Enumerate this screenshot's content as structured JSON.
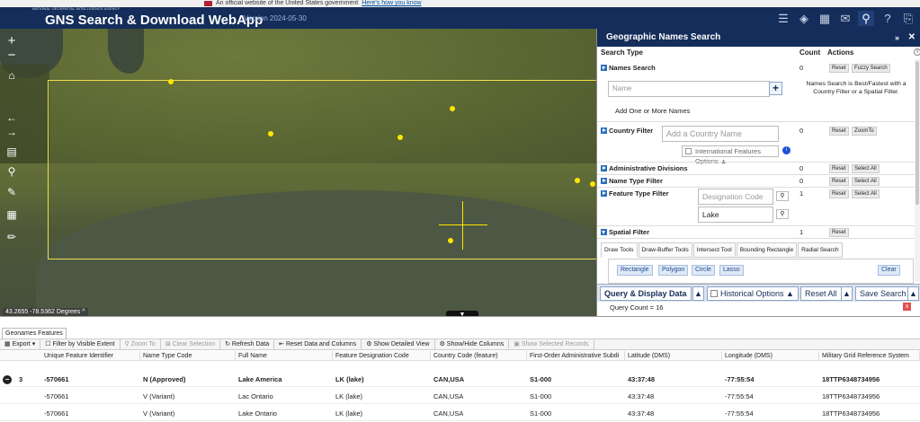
{
  "gov_banner": {
    "text": "An official website of the United States government",
    "link": "Here's how you know"
  },
  "header": {
    "agency": "NATIONAL GEOSPATIAL-INTELLIGENCE AGENCY",
    "title": "GNS Search & Download WebApp",
    "version": "Version 2024-05-30",
    "icons": [
      "list-icon",
      "layers-icon",
      "basemap-icon",
      "feedback-icon",
      "search-icon",
      "help-icon",
      "link-icon"
    ]
  },
  "map": {
    "coordinates": "43.2655 -78.5362 Degrees",
    "coord_toggle": "^",
    "collapse": "▼",
    "tools": [
      "+",
      "−",
      "⌂",
      "←",
      "→",
      "▤",
      "🔍",
      "✎",
      "▦",
      "✏"
    ]
  },
  "panel": {
    "title": "Geographic Names Search",
    "collapse": "»",
    "close": "✕",
    "col_search_type": "Search Type",
    "col_count": "Count",
    "col_actions": "Actions",
    "info_icon": "i",
    "names_search": {
      "label": "Names Search",
      "count": "0",
      "reset": "Reset",
      "fuzzy": "Fuzzy Search",
      "placeholder": "Name",
      "add_btn": "+",
      "hint": "Names Search is Best/Fastest with a Country Filter or a Spatial Filter.",
      "add_more": "Add One or More Names"
    },
    "country_filter": {
      "label": "Country Filter",
      "placeholder": "Add a Country Name",
      "count": "0",
      "reset": "Reset",
      "zoom": "ZoomTo",
      "intl_options": "International Features Options ▲"
    },
    "admin_divisions": {
      "label": "Administrative Divisions",
      "count": "0",
      "reset": "Reset",
      "select_all": "Select All"
    },
    "name_type_filter": {
      "label": "Name Type Filter",
      "count": "0",
      "reset": "Reset",
      "select_all": "Select All"
    },
    "feature_type_filter": {
      "label": "Feature Type Filter",
      "placeholder": "Designation Code",
      "value": "Lake",
      "count": "1",
      "reset": "Reset",
      "select_all": "Select All"
    },
    "spatial_filter": {
      "label": "Spatial Filter",
      "count": "1",
      "reset": "Reset"
    },
    "draw_tabs": [
      "Draw Tools",
      "Draw-Buffer Tools",
      "Intersect Tool",
      "Bounding Rectangle",
      "Radial Search"
    ],
    "draw_buttons": [
      "Rectangle",
      "Polygon",
      "Circle",
      "Lasso"
    ],
    "clear": "Clear",
    "query_btn": "Query & Display Data",
    "historical": "Historical Options ▲",
    "reset_all": "Reset All",
    "save_search": "Save Search",
    "query_count": "Query Count = 16"
  },
  "grid": {
    "tab": "Geonames Features",
    "toolbar": [
      "Export ▾",
      "Filter by Visible Extent",
      "Zoom To",
      "Clear Selection",
      "Refresh Data",
      "Reset Data and Columns",
      "Show Detailed View",
      "Show/Hide Columns",
      "Show Selected Records"
    ],
    "columns": [
      "Unique Feature Identifier",
      "Name Type Code",
      "Full Name",
      "Feature Designation Code",
      "Country Code (feature)",
      "First-Order Administrative Subdi",
      "Latitude (DMS)",
      "Longitude (DMS)",
      "Military Grid Reference System"
    ],
    "group_count": "3",
    "rows": [
      [
        "-570661",
        "N (Approved)",
        "Lake America",
        "LK (lake)",
        "CAN,USA",
        "S1-000",
        "43:37:48",
        "-77:55:54",
        "18TTP6348734956"
      ],
      [
        "-570661",
        "V (Variant)",
        "Lac Ontario",
        "LK (lake)",
        "CAN,USA",
        "S1-000",
        "43:37:48",
        "-77:55:54",
        "18TTP6348734956"
      ],
      [
        "-570661",
        "V (Variant)",
        "Lake Ontario",
        "LK (lake)",
        "CAN,USA",
        "S1-000",
        "43:37:48",
        "-77:55:54",
        "18TTP6348734956"
      ]
    ]
  },
  "colors": {
    "header_bg": "#142d5a",
    "extent": "#f0e04a",
    "point": "#ffe600"
  }
}
